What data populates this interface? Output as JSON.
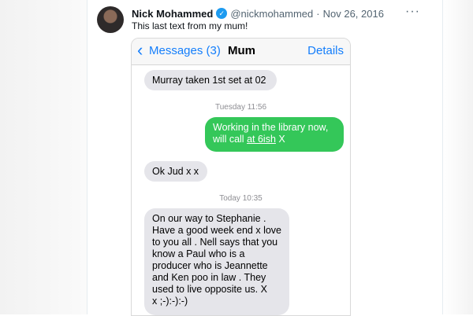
{
  "tweet": {
    "display_name": "Nick Mohammed",
    "handle": "@nickmohammed",
    "separator": "·",
    "date": "Nov 26, 2016",
    "text": "This last text from my mum!",
    "verified_icon": "verified-badge-icon",
    "more_icon": "more-options-icon"
  },
  "messages_app": {
    "back_label": "Messages (3)",
    "contact_name": "Mum",
    "details_label": "Details",
    "timestamps": [
      "Tuesday 11:56",
      "Today 10:35"
    ],
    "bubbles": [
      {
        "direction": "incoming",
        "text": "Murray taken 1st set at  02"
      },
      {
        "direction": "outgoing",
        "text_before": "Working in the library now,\nwill call ",
        "link_text": "at 6ish",
        "text_after": " X"
      },
      {
        "direction": "incoming",
        "text": "Ok Jud x x"
      },
      {
        "direction": "incoming",
        "text": "On our way to Stephanie .\nHave a good week end x love\nto you all . Nell says that you\nknow a Paul who is a\nproducer who is Jeannette\nand Ken  poo in law . They\nused to live opposite us. X\nx ;-):-):-)"
      }
    ],
    "colors": {
      "incoming": "#e5e5ea",
      "outgoing": "#34c759",
      "accent": "#147efb"
    }
  }
}
